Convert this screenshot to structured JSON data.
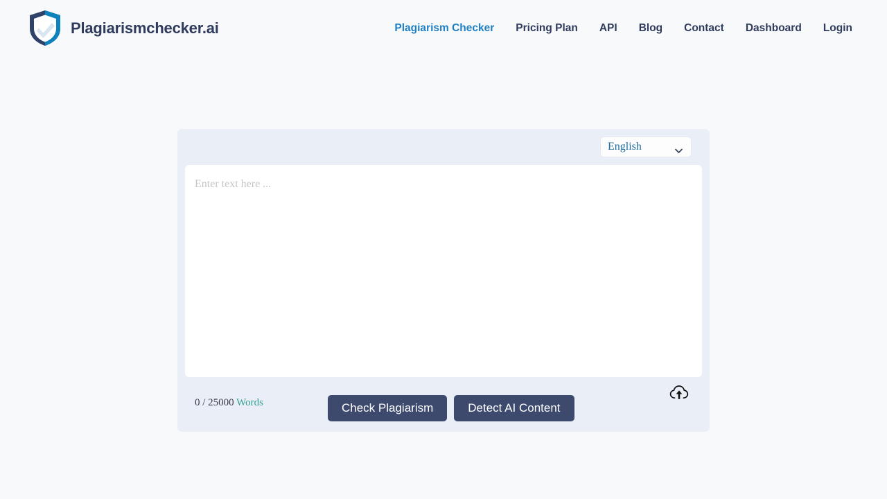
{
  "header": {
    "brand": {
      "logo_icon": "shield-check-logo",
      "name": "Plagiarismchecker.ai",
      "name_color": "#2f3b5c"
    },
    "nav": [
      {
        "label": "Plagiarism Checker",
        "active": true
      },
      {
        "label": "Pricing Plan",
        "active": false
      },
      {
        "label": "API",
        "active": false
      },
      {
        "label": "Blog",
        "active": false
      },
      {
        "label": "Contact",
        "active": false
      },
      {
        "label": "Dashboard",
        "active": false
      },
      {
        "label": "Login",
        "active": false
      }
    ],
    "active_color": "#1f7fc4",
    "inactive_color": "#2f3b5c"
  },
  "editor_panel": {
    "background_color": "#eaeef6",
    "language_select": {
      "selected": "English",
      "icon": "chevron-down-icon"
    },
    "textarea": {
      "value": "",
      "placeholder": "Enter text here ..."
    },
    "word_counter": {
      "current": "0",
      "separator": "/",
      "limit": "25000",
      "label": "Words",
      "label_color": "#349b94",
      "full_text": "0 / 25000 Words"
    },
    "buttons": {
      "check_plagiarism": "Check Plagiarism",
      "detect_ai_content": "Detect AI Content",
      "button_color": "#3d4a6e"
    },
    "upload": {
      "icon": "cloud-upload-icon"
    }
  }
}
